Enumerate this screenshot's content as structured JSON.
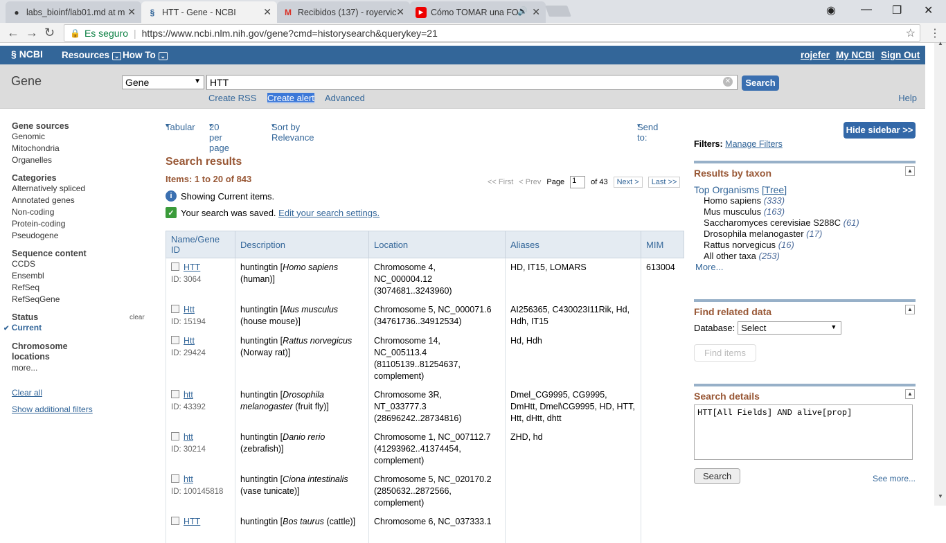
{
  "browser": {
    "tabs": [
      {
        "title": "labs_bioinf/lab01.md at m",
        "icon": "github-icon"
      },
      {
        "title": "HTT - Gene - NCBI",
        "icon": "ncbi-icon"
      },
      {
        "title": "Recibidos (137) - royervic",
        "icon": "gmail-icon"
      },
      {
        "title": "Cómo TOMAR una FO",
        "icon": "youtube-icon"
      }
    ],
    "secure_label": "Es seguro",
    "url": "https://www.ncbi.nlm.nih.gov/gene?cmd=historysearch&querykey=21"
  },
  "ncbi": {
    "logo": "NCBI",
    "resources": "Resources",
    "howto": "How To",
    "user": "rojefer",
    "myncbi": "My NCBI",
    "signout": "Sign Out"
  },
  "search": {
    "title": "Gene",
    "db": "Gene",
    "term": "HTT",
    "button": "Search",
    "create_rss": "Create RSS",
    "create_alert": "Create alert",
    "advanced": "Advanced",
    "help": "Help"
  },
  "filters": {
    "gene_sources": {
      "heading": "Gene sources",
      "items": [
        "Genomic",
        "Mitochondria",
        "Organelles"
      ]
    },
    "categories": {
      "heading": "Categories",
      "items": [
        "Alternatively spliced",
        "Annotated genes",
        "Non-coding",
        "Protein-coding",
        "Pseudogene"
      ]
    },
    "sequence": {
      "heading": "Sequence content",
      "items": [
        "CCDS",
        "Ensembl",
        "RefSeq",
        "RefSeqGene"
      ]
    },
    "status": {
      "heading": "Status",
      "clear": "clear",
      "current": "Current"
    },
    "chrom": {
      "heading1": "Chromosome",
      "heading2": "locations",
      "more": "more..."
    },
    "clear_all": "Clear all",
    "show_additional": "Show additional filters"
  },
  "options": {
    "format": "Tabular",
    "per_page": "20 per page",
    "sort": "Sort by Relevance",
    "send_to": "Send to:"
  },
  "results": {
    "title": "Search results",
    "items": "Items: 1 to 20 of 843",
    "pager": {
      "first": "<< First",
      "prev": "< Prev",
      "page_label": "Page",
      "page": "1",
      "of": "of 43",
      "next": "Next >",
      "last": "Last >>"
    },
    "showing": "Showing Current items.",
    "saved": "Your search was saved.",
    "edit_settings": "Edit your search settings.",
    "columns": [
      "Name/Gene ID",
      "Description",
      "Location",
      "Aliases",
      "MIM"
    ],
    "rows": [
      {
        "name": "HTT",
        "id": "ID: 3064",
        "desc": "huntingtin [",
        "species": "Homo sapiens",
        "common": "(human)]",
        "loc1": "Chromosome 4,",
        "loc2": "NC_000004.12",
        "loc3": "(3074681..3243960)",
        "aliases": "HD, IT15, LOMARS",
        "mim": "613004"
      },
      {
        "name": "Htt",
        "id": "ID: 15194",
        "desc": "huntingtin [",
        "species": "Mus musculus",
        "common": "(house mouse)]",
        "loc1": "Chromosome 5, NC_000071.6",
        "loc2": "(34761736..34912534)",
        "loc3": "",
        "aliases": "AI256365, C430023I11Rik, Hd, Hdh, IT15",
        "mim": ""
      },
      {
        "name": "Htt",
        "id": "ID: 29424",
        "desc": "huntingtin [",
        "species": "Rattus norvegicus",
        "common": "(Norway rat)]",
        "loc1": "Chromosome 14,",
        "loc2": "NC_005113.4",
        "loc3": "(81105139..81254637, complement)",
        "aliases": "Hd, Hdh",
        "mim": ""
      },
      {
        "name": "htt",
        "id": "ID: 43392",
        "desc": "huntingtin [",
        "species": "Drosophila melanogaster",
        "common": "(fruit fly)]",
        "loc1": "Chromosome 3R,",
        "loc2": "NT_033777.3",
        "loc3": "(28696242..28734816)",
        "aliases": "Dmel_CG9995, CG9995, DmHtt, Dmel\\CG9995, HD, HTT, Htt, dHtt, dhtt",
        "mim": ""
      },
      {
        "name": "htt",
        "id": "ID: 30214",
        "desc": "huntingtin [",
        "species": "Danio rerio",
        "common": "(zebrafish)]",
        "loc1": "Chromosome 1, NC_007112.7",
        "loc2": "(41293962..41374454,",
        "loc3": "complement)",
        "aliases": "ZHD, hd",
        "mim": ""
      },
      {
        "name": "htt",
        "id": "ID: 100145818",
        "desc": "huntingtin [",
        "species": "Ciona intestinalis",
        "common": "(vase tunicate)]",
        "loc1": "Chromosome 5, NC_020170.2",
        "loc2": "(2850632..2872566,",
        "loc3": "complement)",
        "aliases": "",
        "mim": ""
      },
      {
        "name": "HTT",
        "id": "",
        "desc": "huntingtin [",
        "species": "Bos taurus",
        "common": "(cattle)]",
        "loc1": "Chromosome 6, NC_037333.1",
        "loc2": "",
        "loc3": "",
        "aliases": "",
        "mim": ""
      }
    ]
  },
  "sidebar": {
    "hide": "Hide sidebar >>",
    "filters_label": "Filters:",
    "manage": "Manage Filters",
    "taxon": {
      "heading": "Results by taxon",
      "top": "Top Organisms",
      "tree": "[Tree]",
      "items": [
        {
          "name": "Homo sapiens",
          "count": "(333)"
        },
        {
          "name": "Mus musculus",
          "count": "(163)"
        },
        {
          "name": "Saccharomyces cerevisiae S288C",
          "count": "(61)"
        },
        {
          "name": "Drosophila melanogaster",
          "count": "(17)"
        },
        {
          "name": "Rattus norvegicus",
          "count": "(16)"
        },
        {
          "name": "All other taxa",
          "count": "(253)"
        }
      ],
      "more": "More..."
    },
    "related": {
      "heading": "Find related data",
      "db_label": "Database:",
      "db_value": "Select",
      "find": "Find items"
    },
    "details": {
      "heading": "Search details",
      "query": "HTT[All Fields] AND alive[prop]",
      "search": "Search",
      "see_more": "See more..."
    }
  }
}
